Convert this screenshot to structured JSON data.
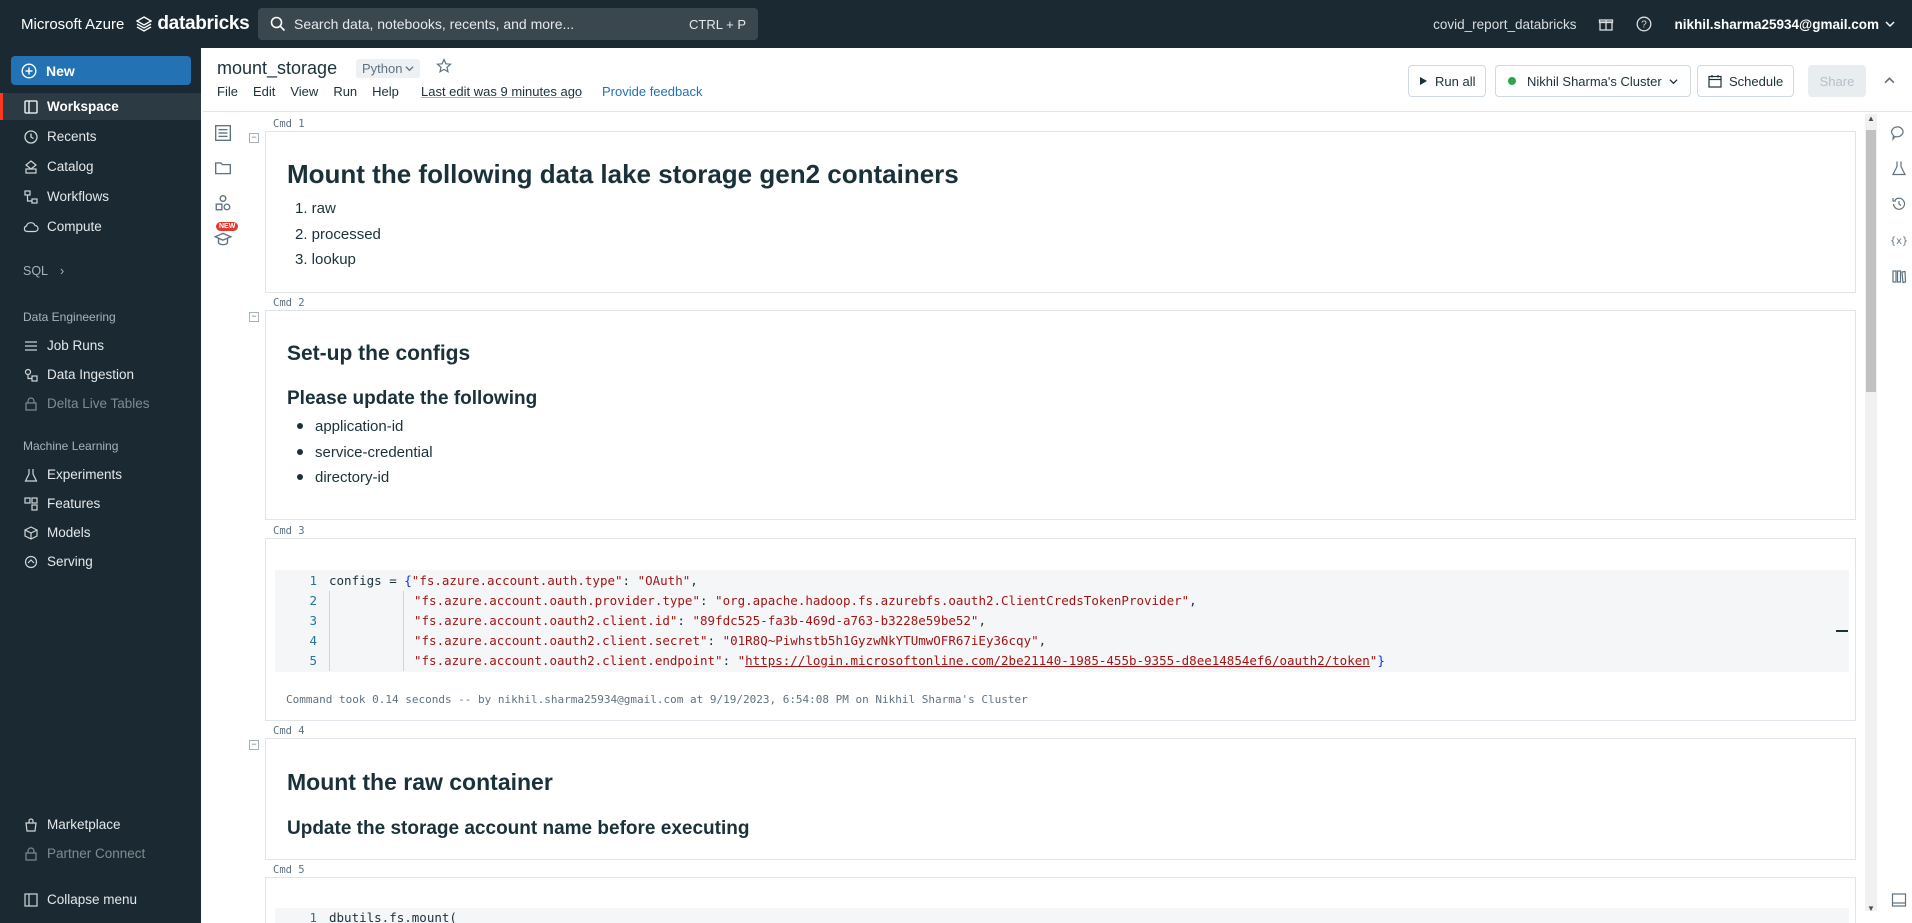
{
  "topbar": {
    "cloud": "Microsoft Azure",
    "brand": "databricks",
    "search_placeholder": "Search data, notebooks, recents, and more...",
    "search_shortcut": "CTRL + P",
    "workspace": "covid_report_databricks",
    "user": "nikhil.sharma25934@gmail.com"
  },
  "sidebar": {
    "new_label": "New",
    "items": [
      {
        "label": "Workspace",
        "icon": "workspace-icon"
      },
      {
        "label": "Recents",
        "icon": "clock-icon"
      },
      {
        "label": "Catalog",
        "icon": "catalog-icon"
      },
      {
        "label": "Workflows",
        "icon": "workflows-icon"
      },
      {
        "label": "Compute",
        "icon": "cloud-icon"
      }
    ],
    "sql_label": "SQL",
    "data_engineering_label": "Data Engineering",
    "data_engineering": [
      {
        "label": "Job Runs",
        "icon": "list-icon"
      },
      {
        "label": "Data Ingestion",
        "icon": "ingestion-icon"
      },
      {
        "label": "Delta Live Tables",
        "icon": "lock-icon"
      }
    ],
    "ml_label": "Machine Learning",
    "ml": [
      {
        "label": "Experiments",
        "icon": "flask-icon"
      },
      {
        "label": "Features",
        "icon": "features-icon"
      },
      {
        "label": "Models",
        "icon": "models-icon"
      },
      {
        "label": "Serving",
        "icon": "serving-icon"
      }
    ],
    "marketplace": "Marketplace",
    "partner_connect": "Partner Connect",
    "collapse": "Collapse menu"
  },
  "notebook": {
    "title": "mount_storage",
    "language": "Python",
    "menu": [
      "File",
      "Edit",
      "View",
      "Run",
      "Help"
    ],
    "last_edit": "Last edit was 9 minutes ago",
    "feedback": "Provide feedback",
    "run_all": "Run all",
    "cluster": "Nikhil Sharma's Cluster",
    "schedule": "Schedule",
    "share": "Share",
    "new_badge": "NEW"
  },
  "cells": {
    "cmd1": {
      "label": "Cmd 1",
      "heading": "Mount the following data lake storage gen2 containers",
      "items": [
        "1. raw",
        "2. processed",
        "3. lookup"
      ]
    },
    "cmd2": {
      "label": "Cmd 2",
      "heading": "Set-up the configs",
      "subheading": "Please update the following",
      "items": [
        "application-id",
        "service-credential",
        "directory-id"
      ]
    },
    "cmd3": {
      "label": "Cmd 3",
      "line_numbers": [
        "1",
        "2",
        "3",
        "4",
        "5"
      ],
      "l1_var": "configs = ",
      "l1_brace": "{",
      "l1_key": "\"fs.azure.account.auth.type\"",
      "l1_val": "\"OAuth\"",
      "l2_key": "\"fs.azure.account.oauth.provider.type\"",
      "l2_val": "\"org.apache.hadoop.fs.azurebfs.oauth2.ClientCredsTokenProvider\"",
      "l3_key": "\"fs.azure.account.oauth2.client.id\"",
      "l3_val": "\"89fdc525-fa3b-469d-a763-b3228e59be52\"",
      "l4_key": "\"fs.azure.account.oauth2.client.secret\"",
      "l4_val": "\"01R8Q~Piwhstb5h1GyzwNkYTUmwOFR67iEy36cqy\"",
      "l5_key": "\"fs.azure.account.oauth2.client.endpoint\"",
      "l5_q": "\"",
      "l5_url": "https://login.microsoftonline.com/2be21140-1985-455b-9355-d8ee14854ef6/oauth2/token",
      "l5_end": "\"",
      "l5_close": "}",
      "result": "Command took 0.14 seconds -- by nikhil.sharma25934@gmail.com at 9/19/2023, 6:54:08 PM on Nikhil Sharma's Cluster"
    },
    "cmd4": {
      "label": "Cmd 4",
      "heading": "Mount the raw container",
      "subheading": "Update the storage account name before executing"
    },
    "cmd5": {
      "label": "Cmd 5",
      "line1_num": "1",
      "line1": "dbutils.fs.mount("
    }
  }
}
